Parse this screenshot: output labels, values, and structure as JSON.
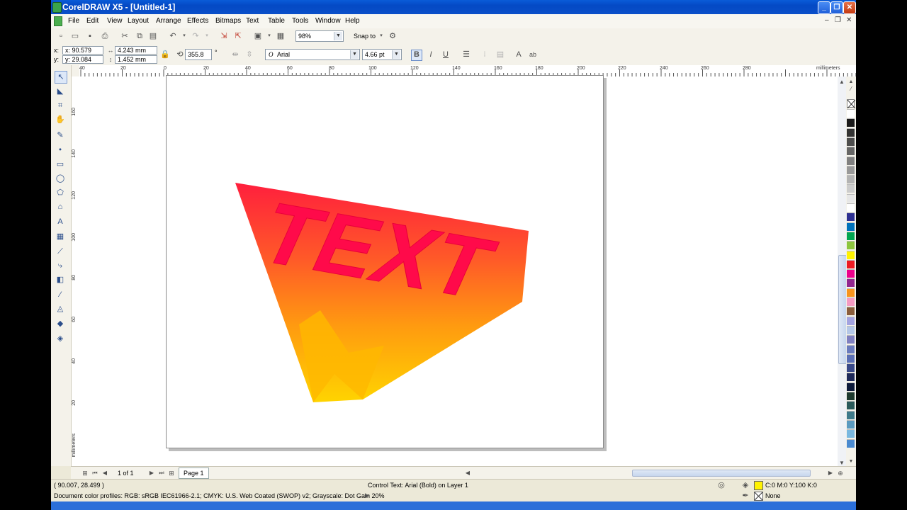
{
  "window": {
    "title": "CorelDRAW X5 - [Untitled-1]",
    "min": "_",
    "max": "❐",
    "close": "✕"
  },
  "menu": [
    "File",
    "Edit",
    "View",
    "Layout",
    "Arrange",
    "Effects",
    "Bitmaps",
    "Text",
    "Table",
    "Tools",
    "Window",
    "Help"
  ],
  "toolbar": {
    "zoom": "98%",
    "snap_to": "Snap to"
  },
  "properties": {
    "x": "x: 90.579 mm",
    "y": "y: 29.084 mm",
    "width": "4.243 mm",
    "height": "1.452 mm",
    "angle": "355.8",
    "degree_symbol": "°",
    "font": "Arial",
    "font_size": "4.66 pt"
  },
  "ruler": {
    "unit": "millimeters",
    "h_ticks": [
      "40",
      "20",
      "0",
      "20",
      "40",
      "60",
      "80",
      "100",
      "120",
      "140",
      "160",
      "180",
      "200",
      "220",
      "240",
      "260",
      "280",
      "300"
    ],
    "v_ticks": [
      "160",
      "140",
      "120",
      "100",
      "80",
      "60",
      "40",
      "20"
    ]
  },
  "artwork": {
    "text": "TEXT"
  },
  "navigator": {
    "page_count": "1 of 1",
    "page_tab": "Page 1"
  },
  "status": {
    "coords": "( 90.007, 28.499 )",
    "object": "Control Text: Arial (Bold) on Layer 1",
    "fill": "C:0 M:0 Y:100 K:0",
    "outline": "None",
    "color_profile": "Document color profiles: RGB: sRGB IEC61966-2.1; CMYK: U.S. Web Coated (SWOP) v2; Grayscale: Dot Gain 20%"
  },
  "palette": [
    "#ffffff",
    "#1a1a1a",
    "#333333",
    "#4d4d4d",
    "#666666",
    "#808080",
    "#999999",
    "#b3b3b3",
    "#cccccc",
    "#e6e6e6",
    "#ffffff",
    "#2e3192",
    "#0072bc",
    "#00a651",
    "#8dc63f",
    "#fff200",
    "#ed1c24",
    "#ec008c",
    "#92278f",
    "#f7941d",
    "#f49ac2",
    "#8b5e3c",
    "#a3a3e0",
    "#b4c7e7",
    "#8080c0",
    "#6a7bbd",
    "#5b6fb5",
    "#3a4a8a",
    "#1f2a5a",
    "#0d1a3a",
    "#1e3a2e",
    "#2a5a5a",
    "#3e7a8a",
    "#5a9ac0",
    "#7ab8e0",
    "#4a8ad0"
  ]
}
